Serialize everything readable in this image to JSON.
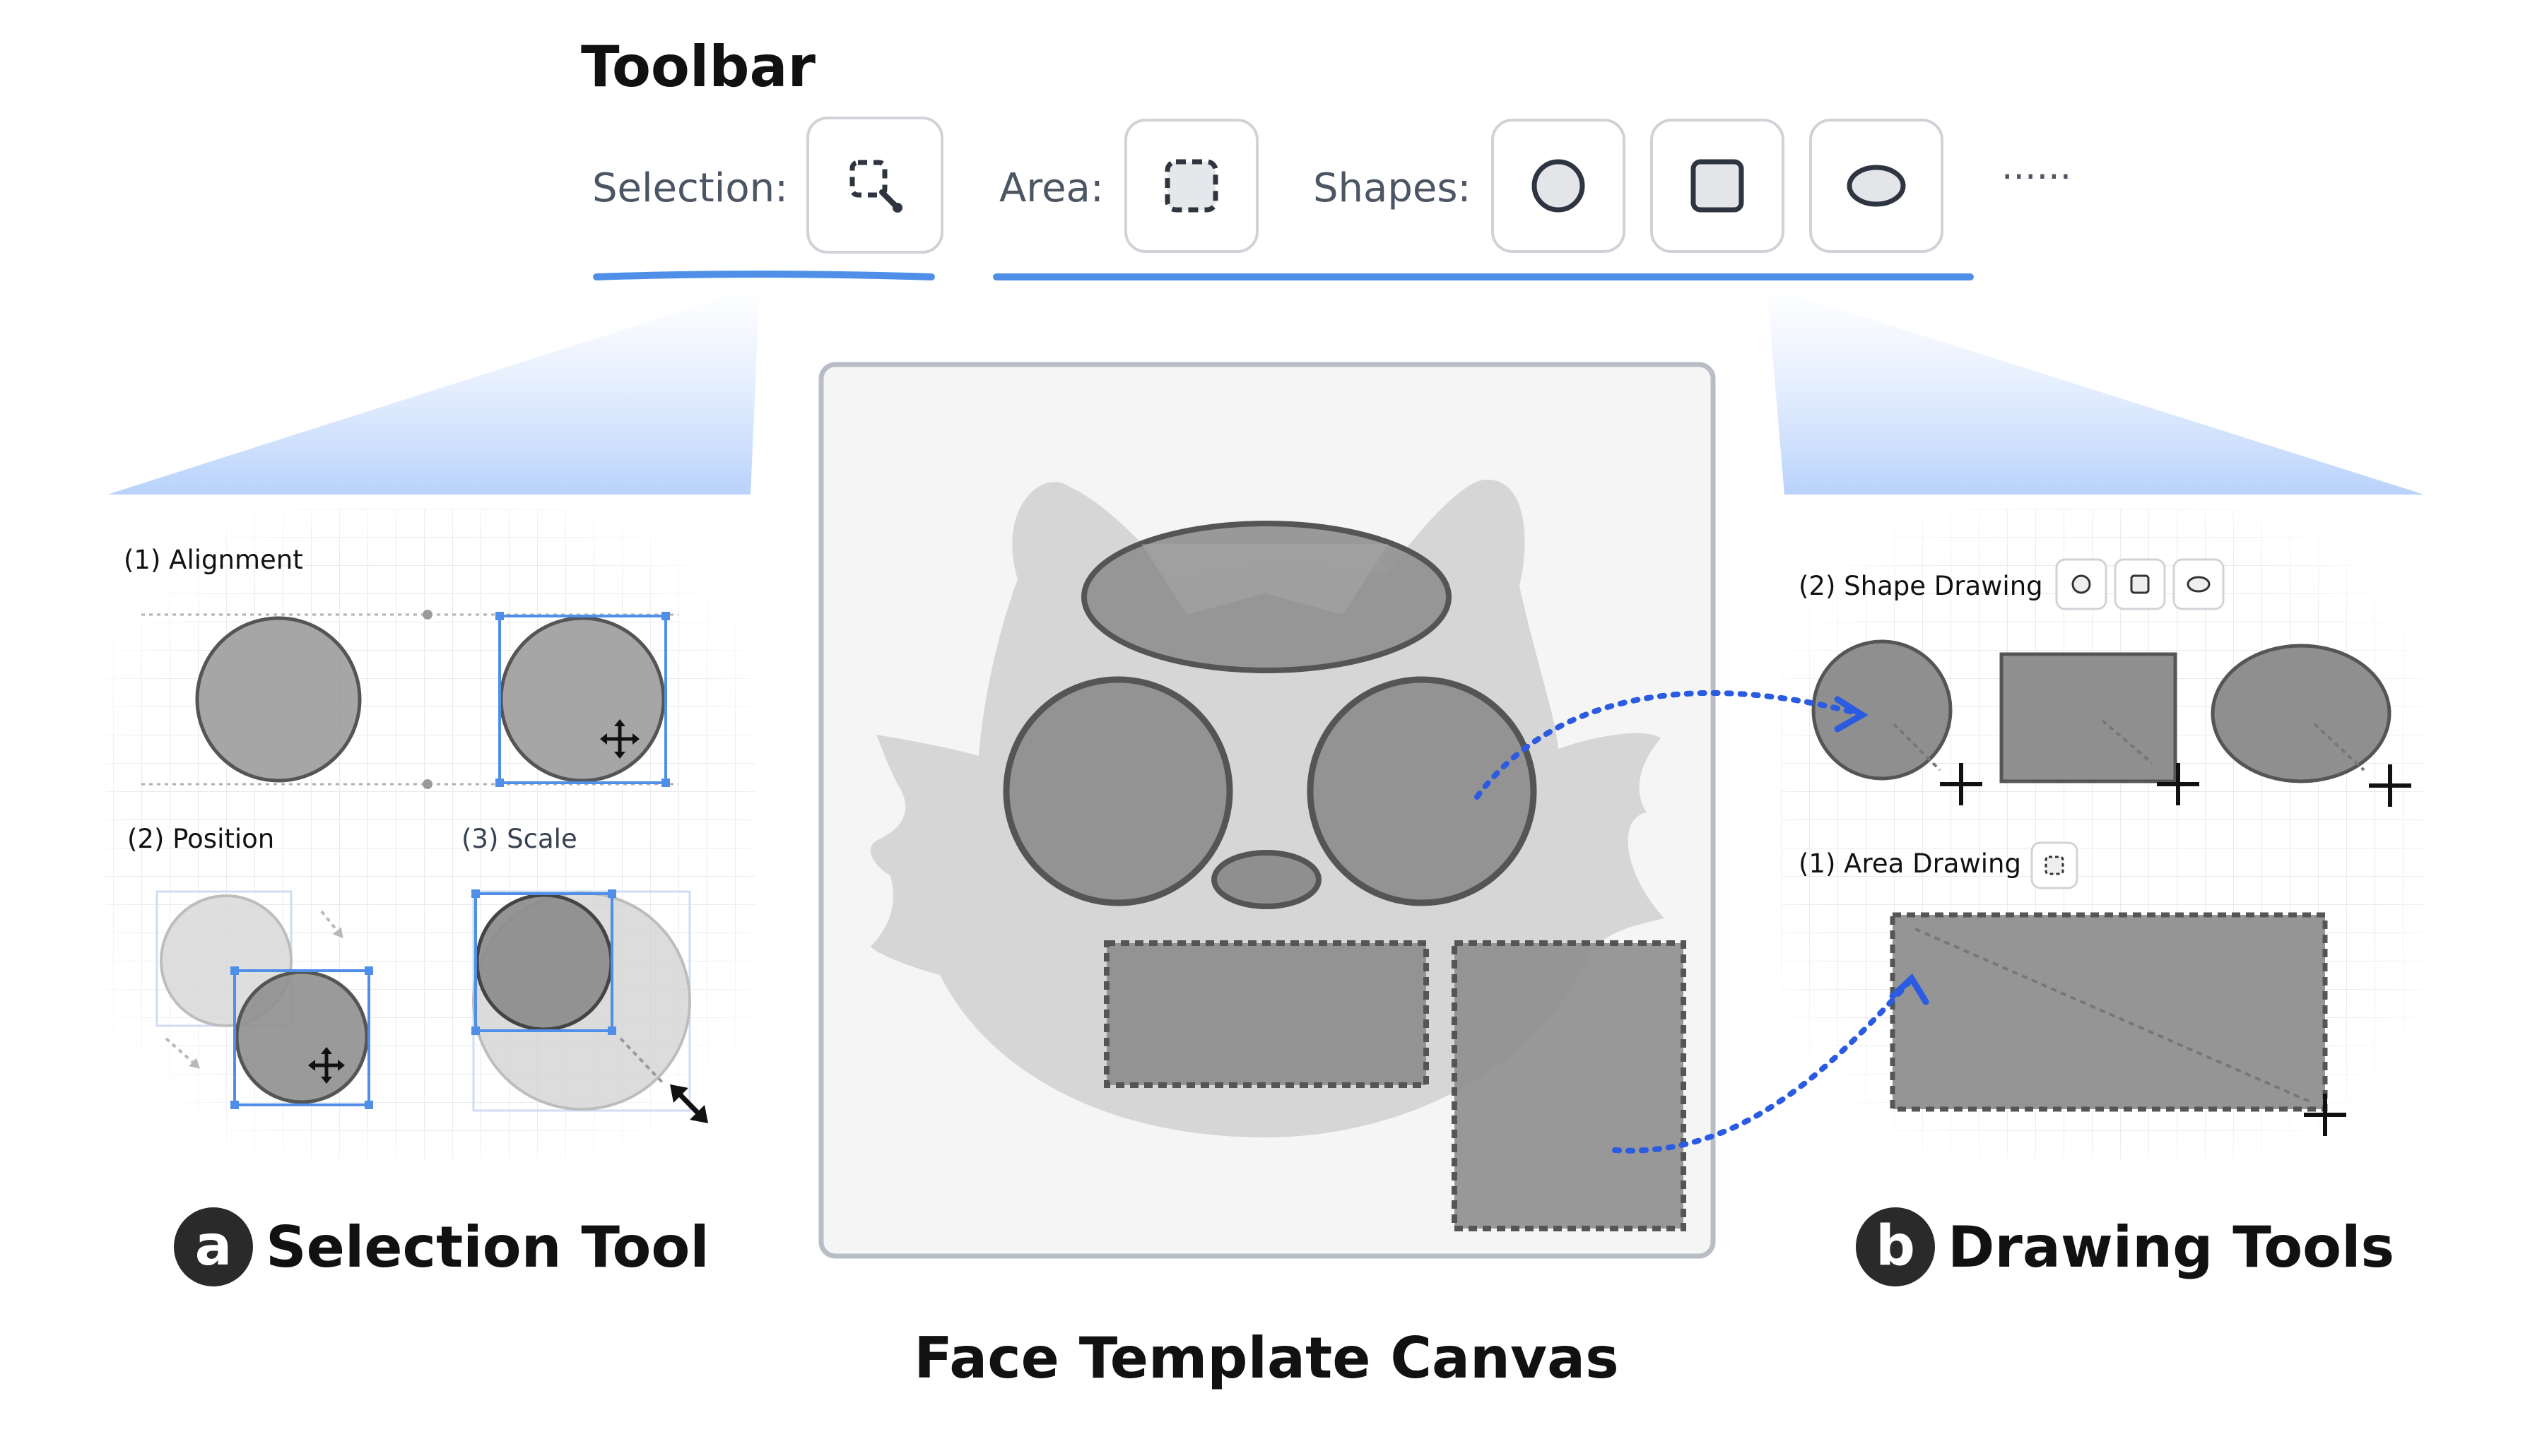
{
  "toolbar": {
    "title": "Toolbar",
    "selection_label": "Selection:",
    "area_label": "Area:",
    "shapes_label": "Shapes:",
    "more_label": "······"
  },
  "selection_panel": {
    "alignment_label": "(1) Alignment",
    "position_label": "(2) Position",
    "scale_label": "(3) Scale",
    "badge": "a",
    "title": "Selection Tool"
  },
  "drawing_panel": {
    "shape_drawing_label": "(2) Shape Drawing",
    "area_drawing_label": "(1) Area Drawing",
    "badge": "b",
    "title": "Drawing Tools"
  },
  "canvas": {
    "title": "Face Template Canvas"
  },
  "colors": {
    "accent_blue": "#4f8fe8",
    "arrow_blue": "#2a5be0",
    "shape_gray": "#8f8f8f",
    "shape_stroke": "#555555",
    "face_gray": "#d4d4d4"
  }
}
